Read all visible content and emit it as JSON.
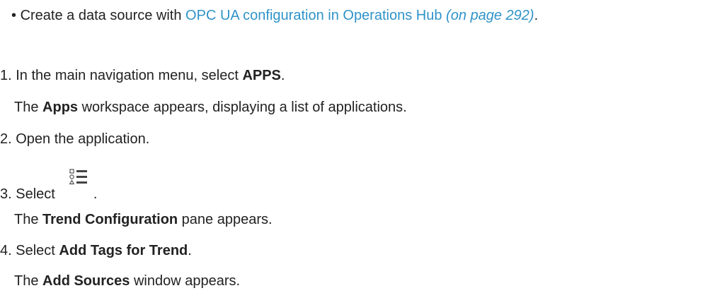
{
  "prereq": {
    "bullet": "•",
    "text_before": "Create a data source with ",
    "link_text": "OPC UA configuration in Operations Hub",
    "page_ref": "(on page 292)",
    "text_after": "."
  },
  "steps": [
    {
      "num": "1.",
      "text_before": "In the main navigation menu, select ",
      "bold": "APPS",
      "text_after": "."
    },
    {
      "result_before": "The ",
      "result_bold": "Apps",
      "result_after": " workspace appears, displaying a list of applications."
    },
    {
      "num": "2.",
      "text": "Open the application."
    },
    {
      "num": "3.",
      "text_before": "Select",
      "icon": "list-config-icon",
      "text_after": "."
    },
    {
      "result_before": "The ",
      "result_bold": "Trend Configuration",
      "result_after": " pane appears."
    },
    {
      "num": "4.",
      "text_before": "Select ",
      "bold": "Add Tags for Trend",
      "text_after": "."
    },
    {
      "result_before": "The ",
      "result_bold": "Add Sources",
      "result_after": " window appears."
    }
  ]
}
